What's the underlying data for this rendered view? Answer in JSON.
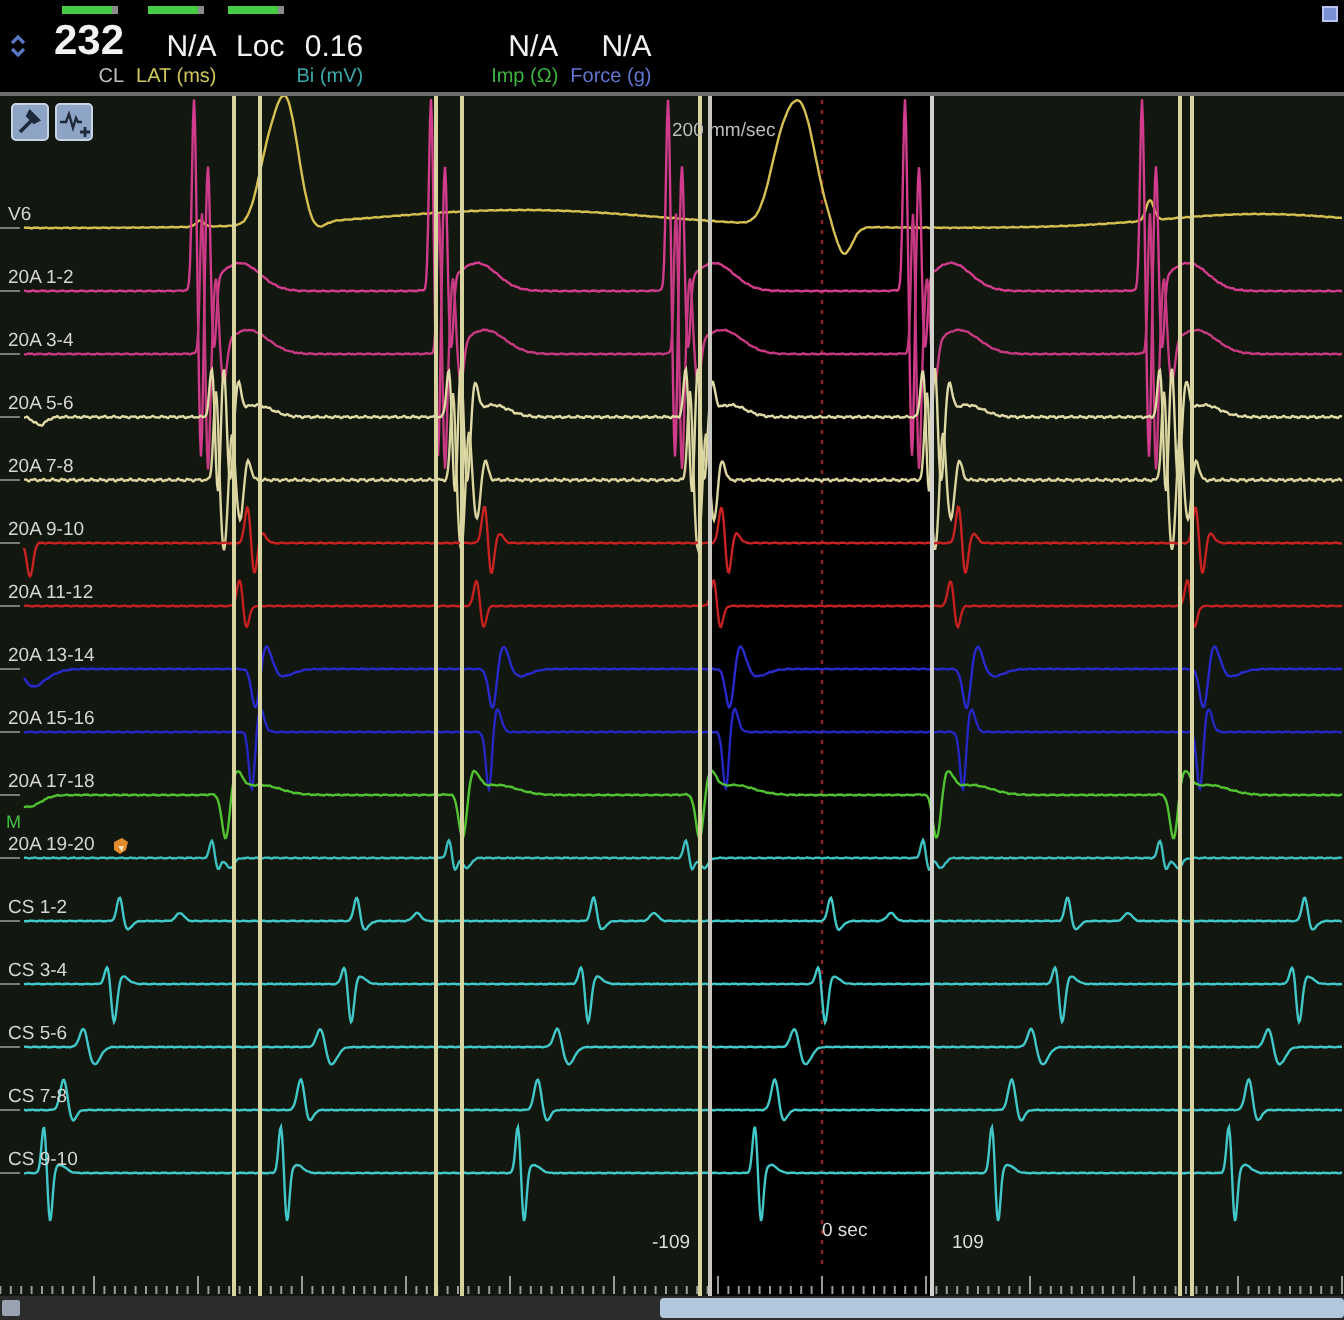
{
  "header": {
    "readings": [
      {
        "value": "232",
        "label": "CL",
        "color": "#c0c0c0",
        "kind": "large",
        "indicator": true
      },
      {
        "value": "N/A",
        "label": "LAT (ms)",
        "color": "#cfc65c",
        "kind": "normal",
        "indicator": true
      },
      {
        "value": "Loc",
        "kind": "normal",
        "indicator": true
      },
      {
        "value": "0.16",
        "label": "Bi (mV)",
        "color": "#3aa9aa",
        "kind": "normal",
        "indicator": false
      }
    ],
    "device_readings": [
      {
        "value": "N/A",
        "label": "Imp (Ω)",
        "color": "#3fb43f",
        "kind": "normal",
        "indicator": false
      },
      {
        "value": "N/A",
        "label": "Force (g)",
        "color": "#6277d2",
        "kind": "normal",
        "indicator": false
      }
    ]
  },
  "panel": {
    "speed_label": "200 mm/sec",
    "channels": [
      {
        "label": "V6",
        "color": "#d6c052",
        "flagged": false
      },
      {
        "label": "20A 1-2",
        "color": "#d23c8c",
        "flagged": false
      },
      {
        "label": "20A 3-4",
        "color": "#c63a82",
        "flagged": false
      },
      {
        "label": "20A 5-6",
        "color": "#e0dba6",
        "flagged": false
      },
      {
        "label": "20A 7-8",
        "color": "#dad59e",
        "flagged": false
      },
      {
        "label": "20A 9-10",
        "color": "#c82222",
        "flagged": false
      },
      {
        "label": "20A 11-12",
        "color": "#c42020",
        "flagged": false
      },
      {
        "label": "20A 13-14",
        "color": "#2a2acc",
        "flagged": false
      },
      {
        "label": "20A 15-16",
        "color": "#2626c2",
        "flagged": false
      },
      {
        "label": "20A 17-18",
        "color": "#52c232",
        "flagged": false
      },
      {
        "label": "20A 19-20",
        "color": "#3ebfc0",
        "flagged": true,
        "tag": "M"
      },
      {
        "label": "CS 1-2",
        "color": "#42c8c8",
        "flagged": false
      },
      {
        "label": "CS 3-4",
        "color": "#42c8c8",
        "flagged": false
      },
      {
        "label": "CS 5-6",
        "color": "#42c8c8",
        "flagged": false
      },
      {
        "label": "CS 7-8",
        "color": "#42c8c8",
        "flagged": false
      },
      {
        "label": "CS 9-10",
        "color": "#42c8c8",
        "flagged": false
      }
    ],
    "time_labels": [
      "-109",
      "0 sec",
      "109"
    ]
  }
}
